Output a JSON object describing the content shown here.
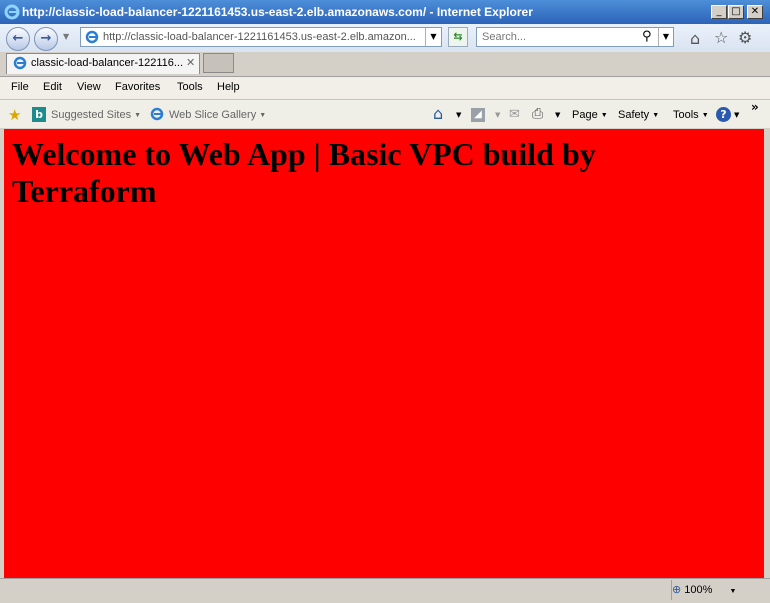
{
  "window": {
    "title": "http://classic-load-balancer-1221161453.us-east-2.elb.amazonaws.com/ - Internet Explorer"
  },
  "address": {
    "url": "http://classic-load-balancer-1221161453.us-east-2.elb.amazon..."
  },
  "search": {
    "placeholder": "Search..."
  },
  "tabs": [
    {
      "label": "classic-load-balancer-122116..."
    }
  ],
  "menu": {
    "file": "File",
    "edit": "Edit",
    "view": "View",
    "favorites": "Favorites",
    "tools": "Tools",
    "help": "Help"
  },
  "favorites_bar": {
    "suggested_sites": "Suggested Sites",
    "web_slice_gallery": "Web Slice Gallery"
  },
  "command_bar": {
    "page": "Page",
    "safety": "Safety",
    "tools": "Tools"
  },
  "page": {
    "heading": "Welcome to Web App | Basic VPC build by Terraform"
  },
  "status": {
    "zoom": "100%"
  },
  "colors": {
    "content_bg": "#ff0000",
    "titlebar": "#2c63b9"
  }
}
